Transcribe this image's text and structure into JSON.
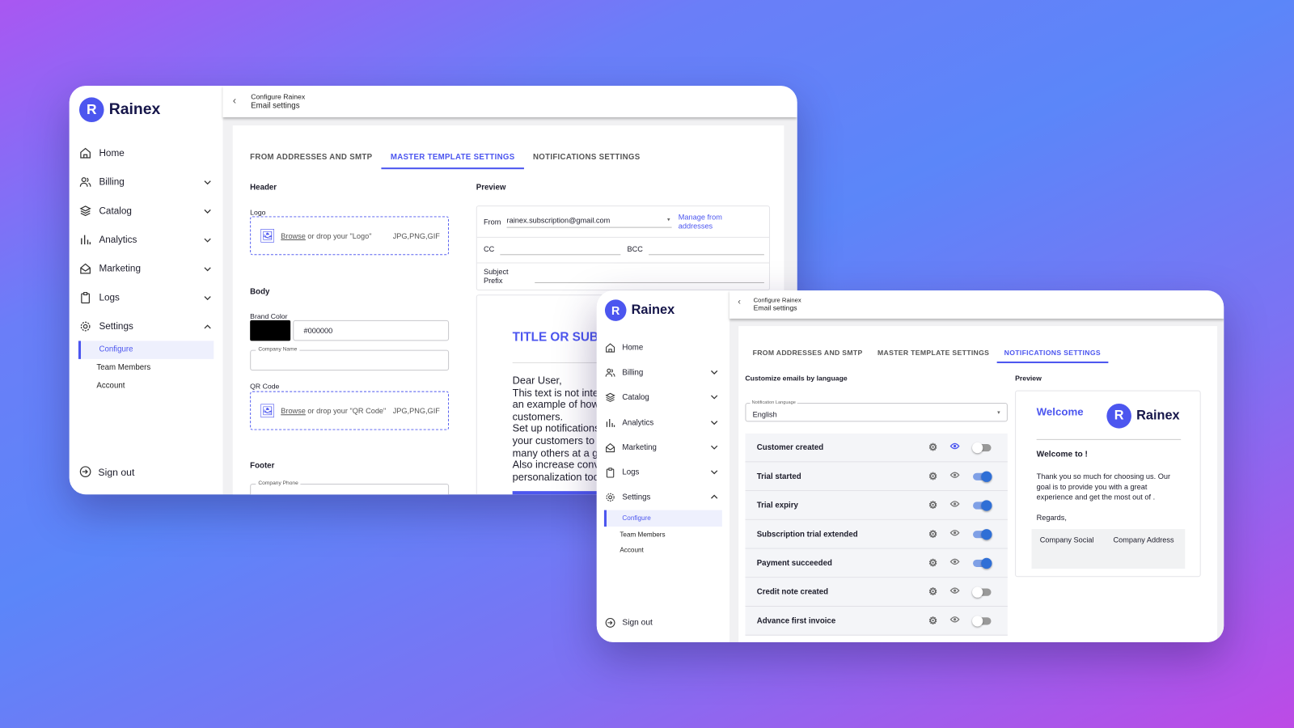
{
  "brand": {
    "name": "Rainex",
    "logo_letter": "R",
    "accent": "#4c56ef"
  },
  "sidebar": {
    "items": [
      {
        "label": "Home",
        "icon": "home-icon",
        "chevron": ""
      },
      {
        "label": "Billing",
        "icon": "users-icon",
        "chevron": "down"
      },
      {
        "label": "Catalog",
        "icon": "layers-icon",
        "chevron": "down"
      },
      {
        "label": "Analytics",
        "icon": "bar-chart-icon",
        "chevron": "down"
      },
      {
        "label": "Marketing",
        "icon": "mail-open-icon",
        "chevron": "down"
      },
      {
        "label": "Logs",
        "icon": "clipboard-icon",
        "chevron": "down"
      },
      {
        "label": "Settings",
        "icon": "gear-icon",
        "chevron": "up"
      }
    ],
    "subitems": [
      {
        "label": "Configure",
        "active": true
      },
      {
        "label": "Team Members"
      },
      {
        "label": "Account"
      }
    ],
    "sign_out": "Sign out"
  },
  "header": {
    "breadcrumb": "Configure Rainex",
    "title": "Email settings"
  },
  "tabs": [
    "FROM ADDRESSES AND SMTP",
    "MASTER TEMPLATE SETTINGS",
    "NOTIFICATIONS SETTINGS"
  ],
  "master": {
    "header_label": "Header",
    "logo_label": "Logo",
    "browse": "Browse",
    "logo_drop": " or drop your \"Logo\"",
    "formats": "JPG,PNG,GIF",
    "body_label": "Body",
    "brand_color_label": "Brand Color",
    "brand_color": "#000000",
    "company_name_label": "Company Name",
    "qr_label": "QR Code",
    "qr_drop": " or drop your \"QR Code\"",
    "footer_label": "Footer",
    "company_phone_label": "Company Phone",
    "preview_label": "Preview",
    "from_label": "From",
    "from_value": "rainex.subscription@gmail.com",
    "manage_link": "Manage from addresses",
    "cc_label": "CC",
    "bcc_label": "BCC",
    "subject_label": "Subject Prefix",
    "email_title": "TITLE OR SUB",
    "email_body": [
      "Dear User,",
      "This text is not inte",
      "an example of how",
      "customers.",
      "Set up notifications",
      "your customers to",
      "many others at a g",
      "Also increase conv",
      "personalization too"
    ]
  },
  "notifications": {
    "section_label": "Customize emails by language",
    "language_label": "Notification Language",
    "language_value": "English",
    "items": [
      {
        "label": "Customer created",
        "enabled": false,
        "previewing": true
      },
      {
        "label": "Trial started",
        "enabled": true
      },
      {
        "label": "Trial expiry",
        "enabled": true
      },
      {
        "label": "Subscription trial extended",
        "enabled": true
      },
      {
        "label": "Payment succeeded",
        "enabled": true
      },
      {
        "label": "Credit note created",
        "enabled": false
      },
      {
        "label": "Advance first invoice",
        "enabled": false
      }
    ],
    "preview_label": "Preview",
    "welcome": "Welcome",
    "greeting": "Welcome to !",
    "message": "Thank you so much for choosing us. Our goal is to provide you with a great experience and get the most out of .",
    "regards": "Regards,",
    "footer_social": "Company Social",
    "footer_address": "Company Address"
  }
}
